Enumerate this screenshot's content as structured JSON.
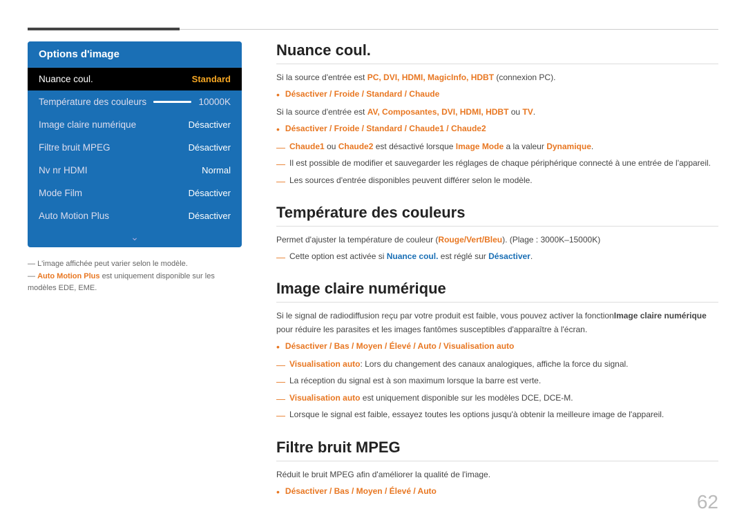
{
  "topLines": {},
  "leftPanel": {
    "title": "Options d'image",
    "menuItems": [
      {
        "label": "Nuance coul.",
        "value": "Standard",
        "active": true
      },
      {
        "label": "Température des couleurs",
        "value": "10000K",
        "slider": true
      },
      {
        "label": "Image claire numérique",
        "value": "Désactiver"
      },
      {
        "label": "Filtre bruit MPEG",
        "value": "Désactiver"
      },
      {
        "label": "Nv nr HDMI",
        "value": "Normal"
      },
      {
        "label": "Mode Film",
        "value": "Désactiver"
      },
      {
        "label": "Auto Motion Plus",
        "value": "Désactiver"
      }
    ],
    "chevron": "⌄",
    "notes": [
      "L'image affichée peut varier selon le modèle.",
      "Auto Motion Plus est uniquement disponible sur les modèles EDE, EME."
    ]
  },
  "sections": [
    {
      "id": "nuance-coul",
      "title": "Nuance coul.",
      "content": [
        {
          "type": "text",
          "text": "Si la source d'entrée est PC, DVI, HDMI, MagicInfo, HDBT (connexion PC)."
        },
        {
          "type": "bullet",
          "text": "Désactiver / Froide / Standard / Chaude"
        },
        {
          "type": "text",
          "text": "Si la source d'entrée est AV, Composantes, DVI, HDMI, HDBT ou TV."
        },
        {
          "type": "bullet",
          "text": "Désactiver / Froide / Standard / Chaude1 / Chaude2"
        },
        {
          "type": "dash",
          "text": "Chaude1 ou Chaude2 est désactivé lorsque Image Mode a la valeur Dynamique."
        },
        {
          "type": "dash",
          "text": "Il est possible de modifier et sauvegarder les réglages de chaque périphérique connecté à une entrée de l'appareil."
        },
        {
          "type": "dash",
          "text": "Les sources d'entrée disponibles peuvent différer selon le modèle."
        }
      ]
    },
    {
      "id": "temperature",
      "title": "Température des couleurs",
      "content": [
        {
          "type": "text",
          "text": "Permet d'ajuster la température de couleur (Rouge/Vert/Bleu). (Plage : 3000K–15000K)"
        },
        {
          "type": "dash",
          "text": "Cette option est activée si Nuance coul. est réglé sur Désactiver."
        }
      ]
    },
    {
      "id": "image-claire",
      "title": "Image claire numérique",
      "content": [
        {
          "type": "text",
          "text": "Si le signal de radiodiffusion reçu par votre produit est faible, vous pouvez activer la fonctionImage claire numérique pour réduire les parasites et les images fantômes susceptibles d'apparaître à l'écran."
        },
        {
          "type": "bullet",
          "text": "Désactiver / Bas / Moyen / Élevé / Auto / Visualisation auto"
        },
        {
          "type": "dash",
          "text": "Visualisation auto: Lors du changement des canaux analogiques, affiche la force du signal."
        },
        {
          "type": "dash",
          "text": "La réception du signal est à son maximum lorsque la barre est verte."
        },
        {
          "type": "dash",
          "text": "Visualisation auto est uniquement disponible sur les modèles DCE, DCE-M."
        },
        {
          "type": "dash",
          "text": "Lorsque le signal est faible, essayez toutes les options jusqu'à obtenir la meilleure image de l'appareil."
        }
      ]
    },
    {
      "id": "filtre-bruit",
      "title": "Filtre bruit MPEG",
      "content": [
        {
          "type": "text",
          "text": "Réduit le bruit MPEG afin d'améliorer la qualité de l'image."
        },
        {
          "type": "bullet",
          "text": "Désactiver / Bas / Moyen / Élevé / Auto"
        }
      ]
    }
  ],
  "pageNumber": "62"
}
